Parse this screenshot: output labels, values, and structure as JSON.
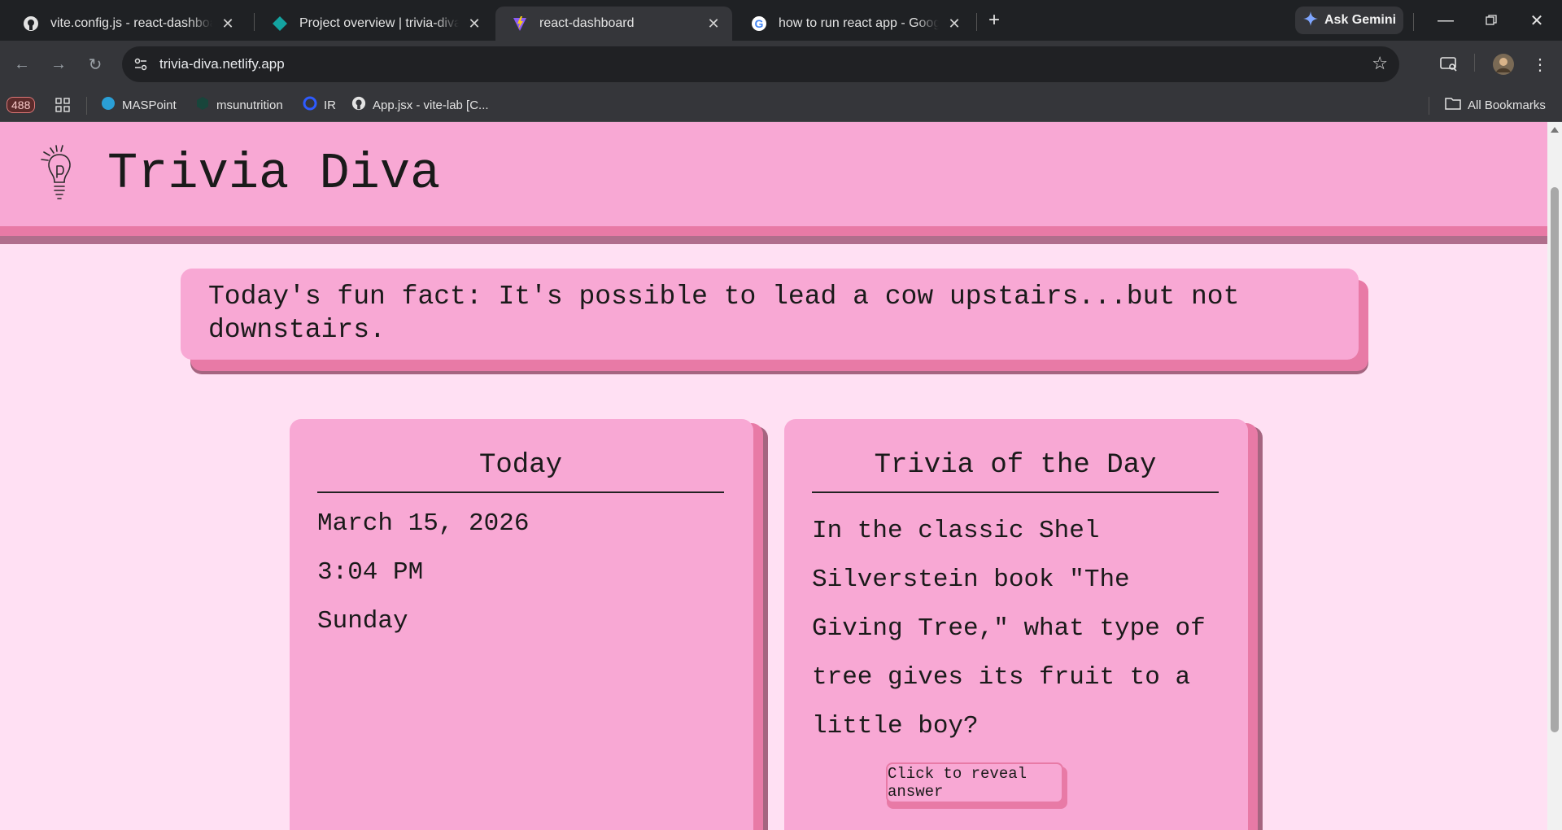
{
  "browser": {
    "tabs": [
      {
        "title": "vite.config.js - react-dashboard",
        "icon": "github-icon"
      },
      {
        "title": "Project overview | trivia-diva | Netlify",
        "icon": "netlify-icon"
      },
      {
        "title": "react-dashboard",
        "icon": "vite-icon",
        "active": true
      },
      {
        "title": "how to run react app - Google Search",
        "icon": "google-icon"
      }
    ],
    "gemini_label": "Ask Gemini",
    "url": "trivia-diva.netlify.app",
    "bookmarks": {
      "badge": "488",
      "items": [
        "MASPoint",
        "msunutrition",
        "IR",
        "App.jsx - vite-lab [C..."
      ],
      "all_bookmarks": "All Bookmarks"
    }
  },
  "page": {
    "site_title": "Trivia Diva",
    "fun_fact": "Today's fun fact: It's possible to lead a cow upstairs...but not downstairs.",
    "today": {
      "title": "Today",
      "date": "March 15, 2026",
      "time": "3:04 PM",
      "weekday": "Sunday"
    },
    "trivia": {
      "title": "Trivia of the Day",
      "question": "In the classic Shel Silverstein book \"The Giving Tree,\" what type of tree gives its fruit to a little boy?",
      "reveal_label": "Click to reveal answer"
    }
  },
  "colors": {
    "page_bg": "#ffe0f3",
    "card_pink": "#f8a8d4",
    "shadow_pink": "#e87aa6",
    "chrome_dark": "#35363a"
  }
}
